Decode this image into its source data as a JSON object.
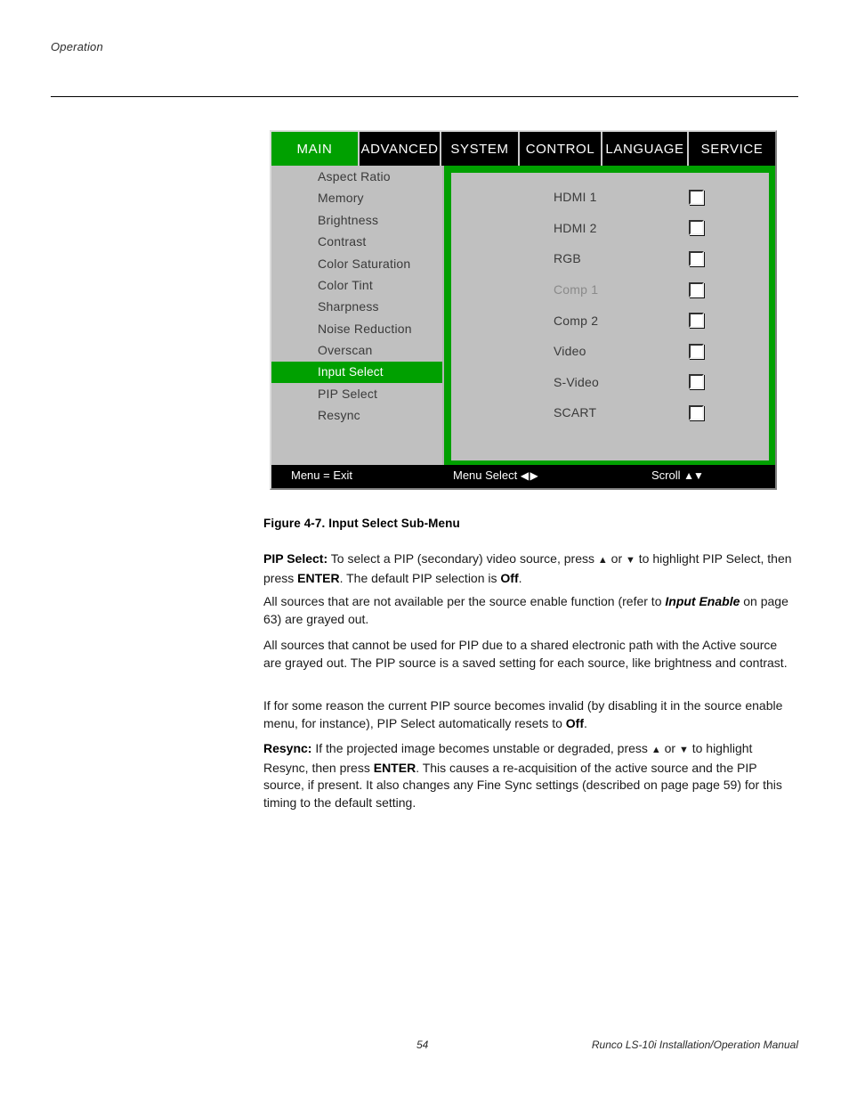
{
  "page": {
    "running_header": "Operation",
    "page_number": "54",
    "manual_title": "Runco LS-10i Installation/Operation Manual"
  },
  "osd": {
    "tabs": [
      {
        "label": "MAIN",
        "active": true
      },
      {
        "label": "ADVANCED",
        "active": false
      },
      {
        "label": "SYSTEM",
        "active": false
      },
      {
        "label": "CONTROL",
        "active": false
      },
      {
        "label": "LANGUAGE",
        "active": false
      },
      {
        "label": "SERVICE",
        "active": false
      }
    ],
    "menu_items": [
      {
        "label": "Aspect Ratio",
        "selected": false
      },
      {
        "label": "Memory",
        "selected": false
      },
      {
        "label": "Brightness",
        "selected": false
      },
      {
        "label": "Contrast",
        "selected": false
      },
      {
        "label": "Color Saturation",
        "selected": false
      },
      {
        "label": "Color Tint",
        "selected": false
      },
      {
        "label": "Sharpness",
        "selected": false
      },
      {
        "label": "Noise Reduction",
        "selected": false
      },
      {
        "label": "Overscan",
        "selected": false
      },
      {
        "label": "Input Select",
        "selected": true
      },
      {
        "label": "PIP Select",
        "selected": false
      },
      {
        "label": "Resync",
        "selected": false
      }
    ],
    "sources": [
      {
        "label": "HDMI 1",
        "checked": false,
        "dimmed": false
      },
      {
        "label": "HDMI 2",
        "checked": false,
        "dimmed": false
      },
      {
        "label": "RGB",
        "checked": false,
        "dimmed": false
      },
      {
        "label": "Comp 1",
        "checked": false,
        "dimmed": true
      },
      {
        "label": "Comp 2",
        "checked": false,
        "dimmed": false
      },
      {
        "label": "Video",
        "checked": false,
        "dimmed": false
      },
      {
        "label": "S-Video",
        "checked": false,
        "dimmed": false
      },
      {
        "label": "SCART",
        "checked": false,
        "dimmed": false
      }
    ],
    "footer": {
      "exit": "Menu = Exit",
      "menu_select": "Menu Select",
      "menu_select_arrows": "◀ ▶",
      "scroll": "Scroll",
      "scroll_arrows": "▲▼"
    },
    "colors": {
      "highlight_green": "#00a000",
      "panel_gray": "#c0c0c0",
      "bar_black": "#000000",
      "text_gray": "#3a3a3a",
      "dim_gray": "#8a8a8a"
    }
  },
  "figure": {
    "caption": "Figure 4-7. Input Select Sub-Menu"
  },
  "body": {
    "p1": {
      "lead": "PIP Select:",
      "t1": " To select a PIP (secondary) video source, press ",
      "up": "▲",
      "t2": " or ",
      "down": "▼",
      "t3": " to highlight PIP Select, then press ",
      "b1": "ENTER",
      "t4": ". The default PIP selection is ",
      "b2": "Off",
      "t5": "."
    },
    "p2": {
      "t1": "All sources that are not available per the source enable function (refer to ",
      "bi1": "Input Enable",
      "t2": " on page 63) are grayed out."
    },
    "p3": {
      "t1": "All sources that cannot be used for PIP due to a shared electronic path with the Active source are grayed out. The PIP source is a saved setting for each source, like brightness and contrast."
    },
    "p4": {
      "t1": "If for some reason the current PIP source becomes invalid (by disabling it in the source enable menu, for instance), PIP Select automatically resets to ",
      "b1": "Off",
      "t2": "."
    },
    "p5": {
      "lead": "Resync:",
      "t1": " If the projected image becomes unstable or degraded, press ",
      "up": "▲",
      "t2": " or ",
      "down": "▼",
      "t3": " to highlight Resync, then press ",
      "b1": "ENTER",
      "t4": ". This causes a re-acquisition of the active source and the PIP source, if present. It also changes any Fine Sync settings (described on page page 59) for this timing to the default setting."
    }
  }
}
